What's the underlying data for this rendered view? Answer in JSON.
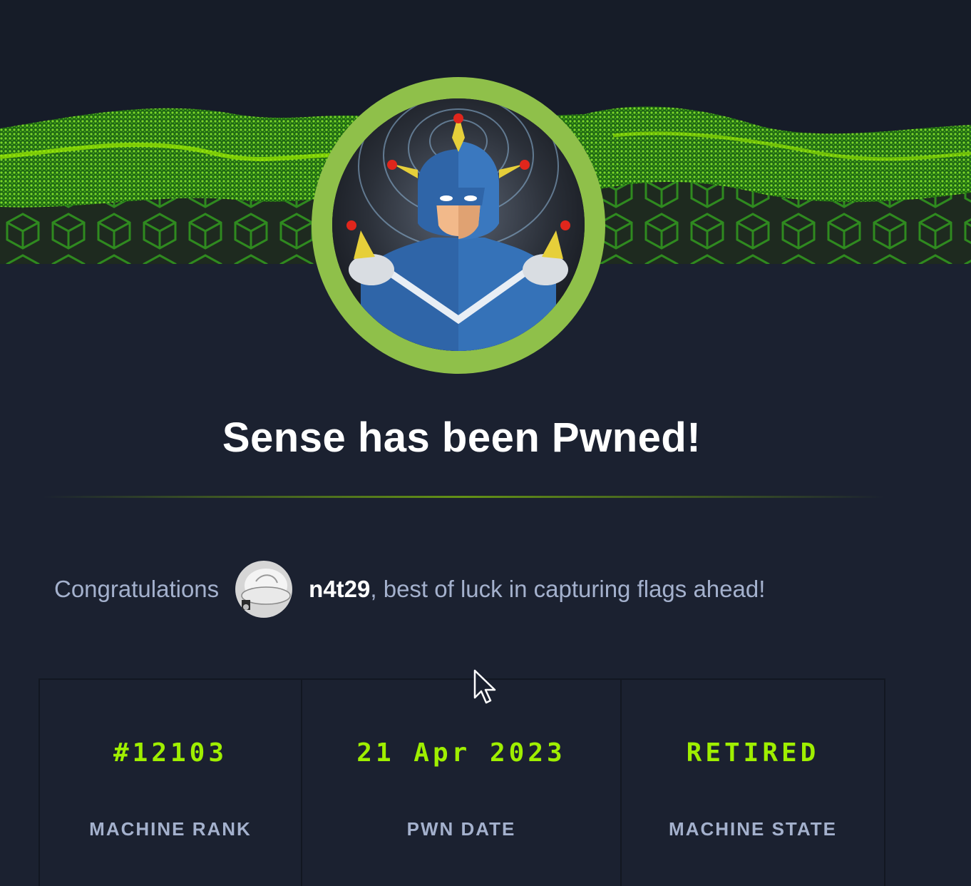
{
  "header": {
    "banner_icon": "green-voxel-wave-banner",
    "machine_avatar_icon": "machine-avatar-icon",
    "ring_color": "#8fc04a"
  },
  "title": "Sense has been Pwned!",
  "congrats": {
    "prefix": "Congratulations",
    "username": "n4t29",
    "suffix": ", best of luck in capturing flags ahead!",
    "user_avatar_icon": "user-avatar-icon"
  },
  "stats": [
    {
      "value": "#12103",
      "label": "MACHINE RANK"
    },
    {
      "value": "21 Apr 2023",
      "label": "PWN DATE"
    },
    {
      "value": "RETIRED",
      "label": "MACHINE STATE"
    }
  ],
  "colors": {
    "background": "#1b2130",
    "accent": "#9fef00",
    "muted_text": "#a4b1cd",
    "title_text": "#ffffff"
  }
}
